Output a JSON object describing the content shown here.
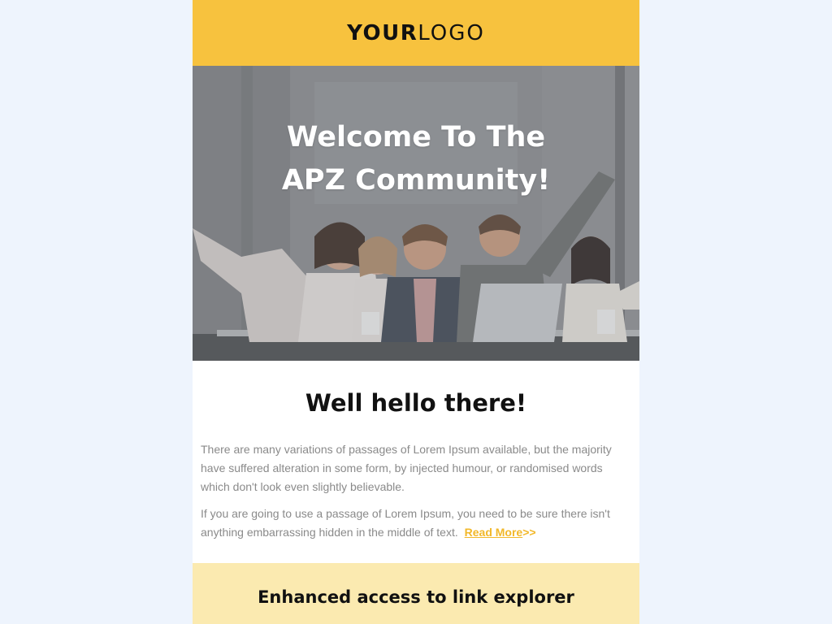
{
  "header": {
    "logo_bold": "YOUR",
    "logo_light": "LOGO"
  },
  "hero": {
    "title_line1": "Welcome To The",
    "title_line2": "APZ Community!",
    "image_icon": "team-photo"
  },
  "main": {
    "heading": "Well hello there!",
    "paragraph1": "There are many variations of passages of Lorem Ipsum available, but the majority have suffered alteration in some form, by injected humour, or randomised words which don't look even slightly believable.",
    "paragraph2": "If you are going to use a passage of Lorem Ipsum, you need to be sure there isn't anything embarrassing hidden in the middle of text.",
    "read_more": "Read More",
    "read_more_suffix": ">>"
  },
  "feature": {
    "heading": "Enhanced access to link explorer"
  },
  "colors": {
    "accent": "#f7c23e",
    "page_bg": "#eef4fd",
    "feature_bg": "#fbeab0",
    "link": "#f2b82a"
  }
}
